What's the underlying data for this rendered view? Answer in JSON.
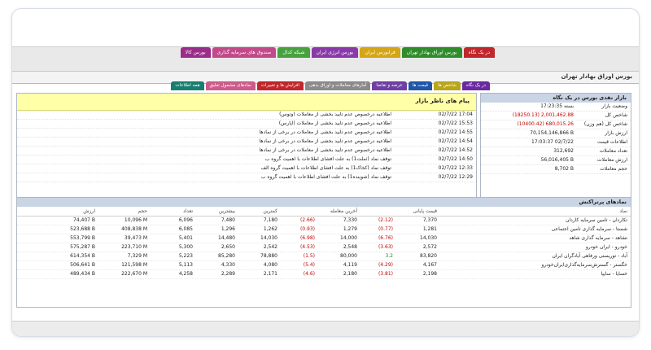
{
  "top_tabs": [
    {
      "label": "در یک نگاه",
      "color": "#c0262b"
    },
    {
      "label": "بورس اوراق بهادار تهران",
      "color": "#2f8c2a"
    },
    {
      "label": "فرابورس ایران",
      "color": "#d4a516"
    },
    {
      "label": "بورس انرژی ایران",
      "color": "#8a3aa8"
    },
    {
      "label": "شبکه کدال",
      "color": "#47a13f"
    },
    {
      "label": "صندوق های سرمایه گذاری",
      "color": "#c24a8a"
    },
    {
      "label": "بورس کالا",
      "color": "#9b2d8a"
    }
  ],
  "page_title": "بورس اوراق بهادار تهران",
  "sub_tabs": [
    {
      "label": "در یک نگاه",
      "color": "#6a2aa0"
    },
    {
      "label": "شاخص ها",
      "color": "#b8a51a"
    },
    {
      "label": "قیمت ها",
      "color": "#1f56a8"
    },
    {
      "label": "عرضه و تقاضا",
      "color": "#6e3fa4"
    },
    {
      "label": "آمارهای معاملات و اوراق بدهی",
      "color": "#8a8a8a"
    },
    {
      "label": "افزایش ها و تغییرات",
      "color": "#c0262b"
    },
    {
      "label": "نمادهای مشمول تعلیق",
      "color": "#cc5b8b"
    },
    {
      "label": "همه اطلاعات",
      "color": "#187f70"
    }
  ],
  "glance": {
    "title": "بازار نقدی بورس در یک نگاه",
    "rows": [
      {
        "label": "وضعیت بازار",
        "value": "بسته 17:23:35",
        "neg": false
      },
      {
        "label": "شاخص کل",
        "value": "(18250.13) 2,001,462.88",
        "neg": true
      },
      {
        "label": "شاخص کل (هم وزن)",
        "value": "(10400.42) 680,015.26",
        "neg": true
      },
      {
        "label": "ارزش بازار",
        "value": "70,154,146,866 B",
        "neg": false
      },
      {
        "label": "اطلاعات قیمت",
        "value": "17:03:37 02/7/22",
        "neg": false
      },
      {
        "label": "تعداد معاملات",
        "value": "312,692",
        "neg": false
      },
      {
        "label": "ارزش معاملات",
        "value": "56,016,405 B",
        "neg": false
      },
      {
        "label": "حجم معاملات",
        "value": "8,702 B",
        "neg": false
      }
    ]
  },
  "news": {
    "title": "پیام های ناظر بازار",
    "items": [
      {
        "time": "02/7/22 17:04",
        "text": "اطلاعیه درخصوص عدم تایید بخشی از معاملات (وتوس)"
      },
      {
        "time": "02/7/22 15:53",
        "text": "اطلاعیه درخصوص عدم تایید بخشی از معاملات (اپارس)"
      },
      {
        "time": "02/7/22 14:55",
        "text": "اطلاعیه درخصوص عدم تایید بخشی از معاملات در برخی از نمادها"
      },
      {
        "time": "02/7/22 14:54",
        "text": "اطلاعیه درخصوص عدم تایید بخشی از معاملات در برخی از نمادها"
      },
      {
        "time": "02/7/22 14:52",
        "text": "اطلاعیه درخصوص عدم تایید بخشی از معاملات در برخی از نمادها"
      },
      {
        "time": "02/7/22 14:50",
        "text": "توقف نماد (ثملت1) به علت افشای اطلاعات با اهمیت گروه ب"
      },
      {
        "time": "02/7/22 12:33",
        "text": "توقف نماد (کخاک1) به علت افشای اطلاعات با اهمیت گروه الف"
      },
      {
        "time": "02/7/22 12:29",
        "text": "توقف نماد (شوینده1) به علت افشای اطلاعات با اهمیت گروه ب"
      }
    ]
  },
  "active": {
    "title": "نمادهای پرتراکنش",
    "columns": {
      "name": "نماد",
      "close": "قیمت پایانی",
      "last": "آخرین معامله",
      "low": "کمترین",
      "high": "بیشترین",
      "count": "تعداد",
      "volume": "حجم",
      "value": "ارزش"
    },
    "rows": [
      {
        "name": "تکاردان - تامین سرمایه کاردان",
        "close": "7,370",
        "close_chg": "(2.12)",
        "last": "7,330",
        "last_chg": "(2.66)",
        "low": "7,180",
        "high": "7,480",
        "count": "6,096",
        "volume": "10,096 M",
        "value": "74,407 B"
      },
      {
        "name": "شستا - سرمایه گذاری تامین اجتماعی",
        "close": "1,281",
        "close_chg": "(0.77)",
        "last": "1,279",
        "last_chg": "(0.93)",
        "low": "1,262",
        "high": "1,296",
        "count": "6,085",
        "volume": "408,838 M",
        "value": "523,688 B"
      },
      {
        "name": "تشاهد - سرمایه گذاری شاهد",
        "close": "14,030",
        "close_chg": "(6.76)",
        "last": "14,000",
        "last_chg": "(6.98)",
        "low": "14,030",
        "high": "14,480",
        "count": "5,401",
        "volume": "39,473 M",
        "value": "553,799 B"
      },
      {
        "name": "خودرو - ایران خودرو",
        "close": "2,572",
        "close_chg": "(3.63)",
        "last": "2,548",
        "last_chg": "(4.53)",
        "low": "2,542",
        "high": "2,650",
        "count": "5,300",
        "volume": "223,710 M",
        "value": "575,287 B"
      },
      {
        "name": "آباد - توریستی ورفاهی آبادگران ایران",
        "close": "83,820",
        "close_chg": "3.2",
        "last": "80,000",
        "last_chg": "(1.5)",
        "low": "78,880",
        "high": "85,280",
        "count": "5,223",
        "volume": "7,329 M",
        "value": "614,354 B"
      },
      {
        "name": "خگستر - گسترش‌سرمایه‌گذاری‌ایران‌خودرو",
        "close": "4,167",
        "close_chg": "(4.29)",
        "last": "4,119",
        "last_chg": "(5.4)",
        "low": "4,080",
        "high": "4,330",
        "count": "5,113",
        "volume": "121,598 M",
        "value": "506,641 B"
      },
      {
        "name": "خسایا - سایپا",
        "close": "2,198",
        "close_chg": "(3.81)",
        "last": "2,180",
        "last_chg": "(4.6)",
        "low": "2,171",
        "high": "2,289",
        "count": "4,258",
        "volume": "222,670 M",
        "value": "489,434 B"
      }
    ]
  }
}
